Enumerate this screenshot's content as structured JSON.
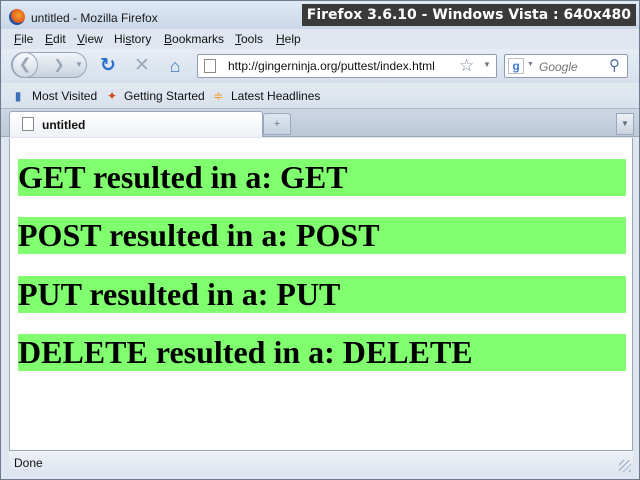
{
  "window": {
    "title": "untitled - Mozilla Firefox",
    "overlay_label": "Firefox 3.6.10 - Windows Vista : 640x480"
  },
  "menubar": {
    "items": [
      {
        "first": "F",
        "rest": "ile"
      },
      {
        "first": "E",
        "rest": "dit"
      },
      {
        "first": "V",
        "rest": "iew"
      },
      {
        "first": "H",
        "pre": "Hi",
        "u": "s",
        "post": "tory"
      },
      {
        "first": "B",
        "rest": "ookmarks"
      },
      {
        "first": "T",
        "rest": "ools"
      },
      {
        "first": "H",
        "rest": "elp"
      }
    ]
  },
  "navbar": {
    "url": "http://gingerninja.org/puttest/index.html",
    "search_placeholder": "Google",
    "search_engine_icon": "google-icon"
  },
  "bookmarks": [
    {
      "label": "Most Visited",
      "icon": "bookmark-icon"
    },
    {
      "label": "Getting Started",
      "icon": "firefox-icon"
    },
    {
      "label": "Latest Headlines",
      "icon": "rss-icon"
    }
  ],
  "tabs": [
    {
      "label": "untitled",
      "active": true
    }
  ],
  "content": {
    "results": [
      "GET resulted in a: GET",
      "POST resulted in a: POST",
      "PUT resulted in a: PUT",
      "DELETE resulted in a: DELETE"
    ],
    "result_background": "#80ff6f"
  },
  "status": {
    "text": "Done"
  }
}
